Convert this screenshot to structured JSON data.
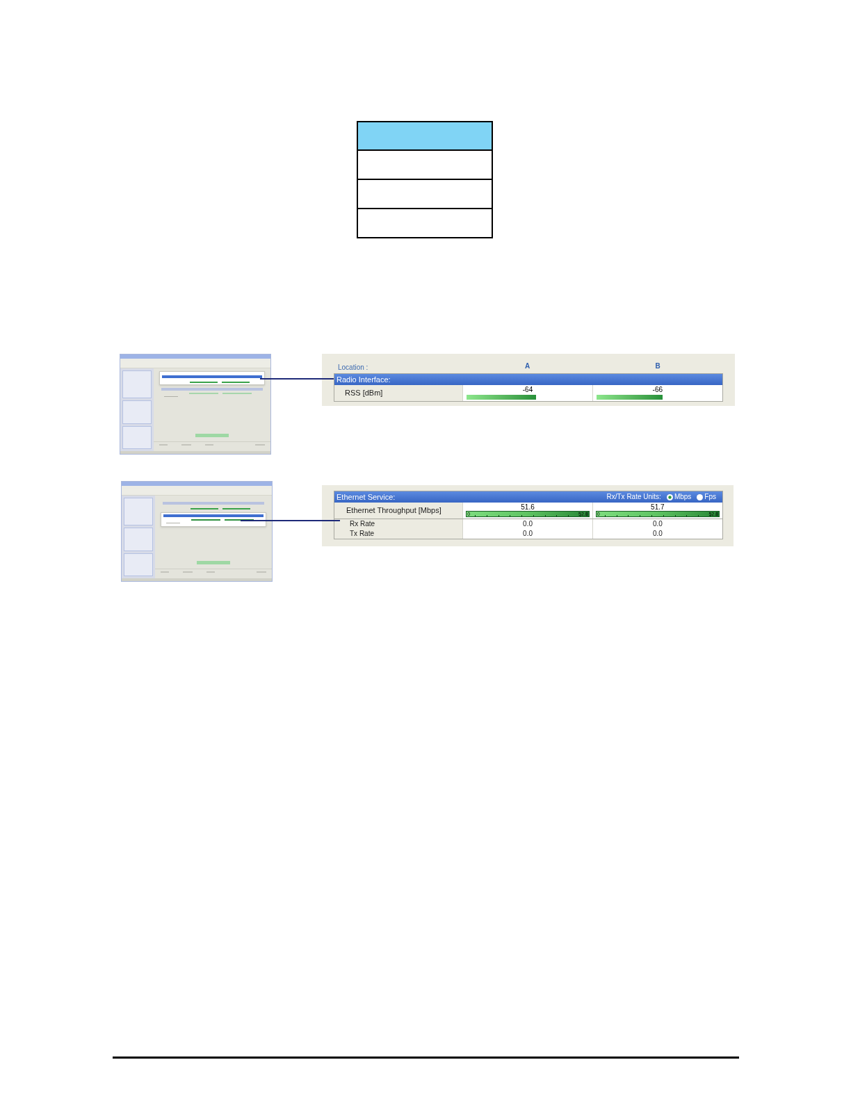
{
  "table": {
    "rows": [
      {
        "kind": "header"
      },
      {
        "kind": "body"
      },
      {
        "kind": "body"
      },
      {
        "kind": "body"
      }
    ]
  },
  "figures": [
    {
      "kind": "radio",
      "location_label": "Location :",
      "columns": [
        "A",
        "B"
      ],
      "section": {
        "title": "Radio Interface:"
      },
      "rows": [
        {
          "kind": "bar",
          "label": "RSS [dBm]",
          "cells": [
            {
              "value": "-64",
              "level": 0.57
            },
            {
              "value": "-66",
              "level": 0.54
            }
          ]
        }
      ]
    },
    {
      "kind": "ethernet",
      "section": {
        "title": "Ethernet Service:",
        "units_label": "Rx/Tx Rate Units:",
        "units": [
          {
            "label": "Mbps",
            "selected": true
          },
          {
            "label": "Fps",
            "selected": false
          }
        ]
      },
      "rows": [
        {
          "kind": "meter",
          "label": "Ethernet Throughput [Mbps]",
          "cells": [
            {
              "value": "51.6",
              "min": "0",
              "max": "52.8",
              "level": 0.98
            },
            {
              "value": "51.7",
              "min": "0",
              "max": "52.8",
              "level": 0.98
            }
          ]
        },
        {
          "kind": "text",
          "label": "Rx Rate",
          "cells": [
            {
              "value": "0.0"
            },
            {
              "value": "0.0"
            }
          ]
        },
        {
          "kind": "text",
          "label": "Tx Rate",
          "cells": [
            {
              "value": "0.0"
            },
            {
              "value": "0.0"
            }
          ]
        }
      ]
    }
  ]
}
